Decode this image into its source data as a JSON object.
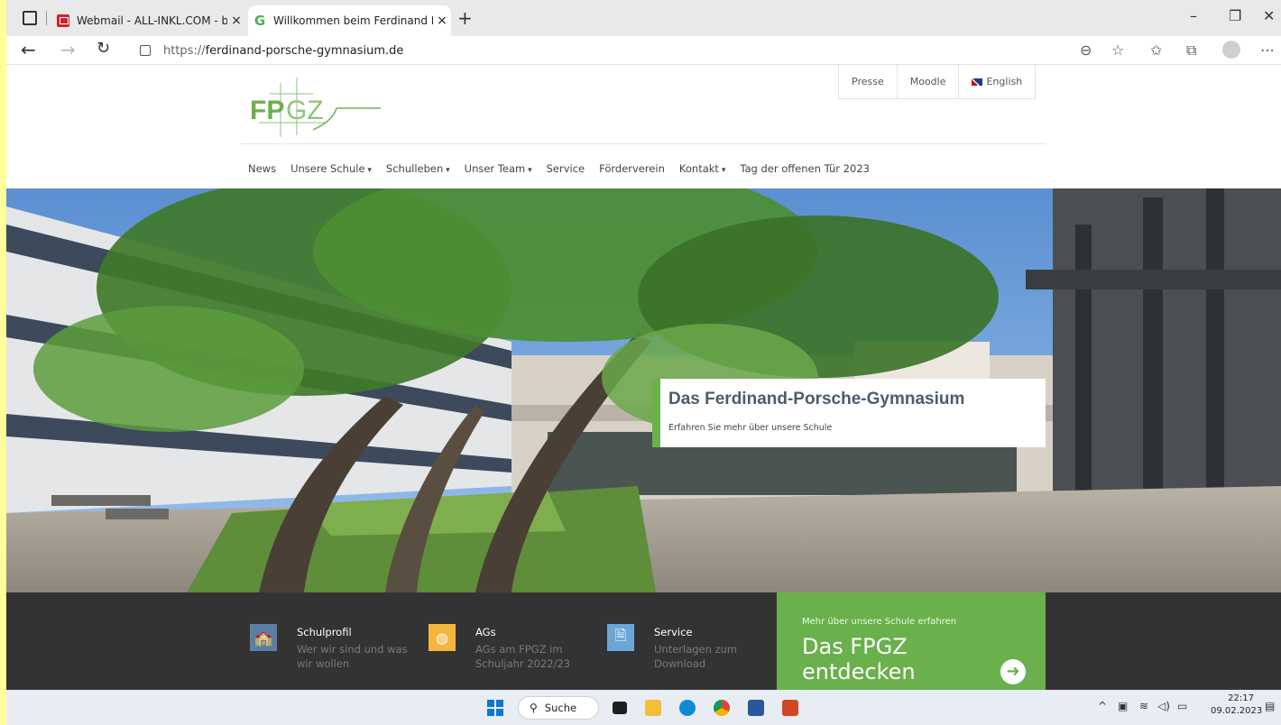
{
  "browser": {
    "tabs": [
      {
        "label": "Webmail - ALL-INKL.COM - bc@",
        "close": "×"
      },
      {
        "label": "Willkommen beim Ferdinand Por",
        "close": "×"
      }
    ],
    "new_tab": "+",
    "url_prefix": "https://",
    "url_host": "ferdinand-porsche-gymnasium.de",
    "window_controls": {
      "minimize": "–",
      "restore": "❐",
      "close": "✕"
    },
    "toolbar_icons": [
      "zoom-out-icon",
      "add-favorite-icon",
      "favorites-icon",
      "collections-icon",
      "profile-icon",
      "more-icon"
    ]
  },
  "site": {
    "top_links": [
      "Presse",
      "Moodle",
      "English"
    ],
    "logo_text": "FPGZ",
    "nav": [
      {
        "label": "News",
        "dropdown": false
      },
      {
        "label": "Unsere Schule",
        "dropdown": true
      },
      {
        "label": "Schulleben",
        "dropdown": true
      },
      {
        "label": "Unser Team",
        "dropdown": true
      },
      {
        "label": "Service",
        "dropdown": false
      },
      {
        "label": "Förderverein",
        "dropdown": false
      },
      {
        "label": "Kontakt",
        "dropdown": true
      },
      {
        "label": "Tag der offenen Tür 2023",
        "dropdown": false
      }
    ],
    "hero": {
      "heading": "Das Ferdinand-Porsche-Gymnasium",
      "subheading": "Erfahren Sie mehr über unsere Schule"
    },
    "features": [
      {
        "title": "Schulprofil",
        "desc": "Wer wir sind und was wir wollen",
        "icon": "school-building-icon",
        "color": "#5a7fa2"
      },
      {
        "title": "AGs",
        "desc": "AGs am FPGZ im Schuljahr 2022/23",
        "icon": "basketball-icon",
        "color": "#f4b63f"
      },
      {
        "title": "Service",
        "desc": "Unterlagen zum Download",
        "icon": "document-search-icon",
        "color": "#6aa7d6"
      }
    ],
    "cta": {
      "kicker": "Mehr über unsere Schule erfahren",
      "text": "Das FPGZ entdecken"
    }
  },
  "taskbar": {
    "search_label": "Suche",
    "time": "22:17",
    "date": "09.02.2023"
  },
  "colors": {
    "accent_green": "#6ab04c",
    "band_dark": "#333333",
    "page_bg": "#ffff99"
  }
}
